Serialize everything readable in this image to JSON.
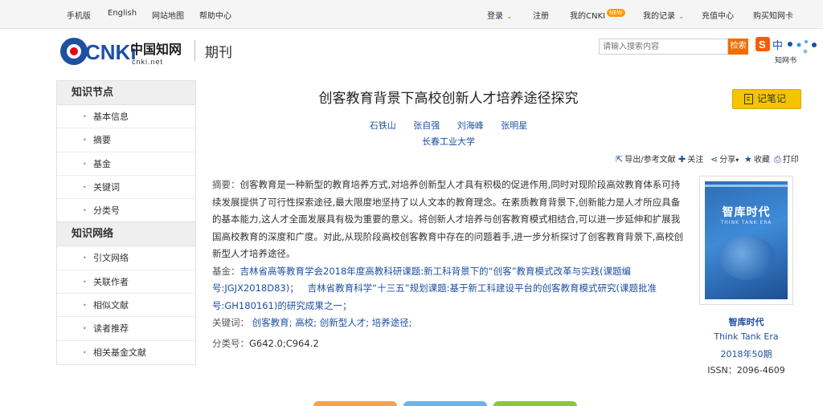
{
  "topbar": {
    "mobile": "手机版",
    "english": "English",
    "sitemap": "网站地图",
    "help": "帮助中心",
    "login": "登录",
    "register": "注册",
    "my_cnki": "我的CNKI",
    "new_badge": "NEW",
    "my_records": "我的记录",
    "recharge": "充值中心",
    "buy_card": "购买知网卡"
  },
  "header": {
    "logo_text": "CNKi",
    "logo_cn": "中国知网",
    "logo_url": "cnki.net",
    "section": "期刊",
    "search_placeholder": "请输入搜索内容",
    "search_button": "检索",
    "sogou_text": "中",
    "sogou_sub": "知网书"
  },
  "sidebar": {
    "knowledge_nodes": {
      "title": "知识节点",
      "items": [
        "基本信息",
        "摘要",
        "基金",
        "关键词",
        "分类号"
      ]
    },
    "knowledge_network": {
      "title": "知识网络",
      "items": [
        "引文网络",
        "关联作者",
        "相似文献",
        "读者推荐",
        "相关基金文献"
      ]
    }
  },
  "article": {
    "title": "创客教育背景下高校创新人才培养途径探究",
    "authors": [
      "石铁山",
      "张自强",
      "刘海峰",
      "张明星"
    ],
    "organization": "长春工业大学",
    "note_button": "记笔记",
    "tools": {
      "export": "导出/参考文献",
      "follow": "关注",
      "share": "分享",
      "favorite": "收藏",
      "print": "打印"
    },
    "abstract_label": "摘要：",
    "abstract": "创客教育是一种新型的教育培养方式,对培养创新型人才具有积极的促进作用,同时对现阶段高效教育体系可持续发展提供了可行性探索途径,最大限度地坚持了以人文本的教育理念。在素质教育背景下,创新能力是人才所应具备的基本能力,这人才全面发展具有极为重要的意义。将创新人才培养与创客教育模式相结合,可以进一步延伸和扩展我国高校教育的深度和广度。对此,从现阶段高校创客教育中存在的问题着手,进一步分析探讨了创客教育背景下,高校创新型人才培养途径。",
    "fund_label": "基金：",
    "fund_1": "吉林省高等教育学会2018年度高教科研课题:新工科背景下的“创客”教育模式改革与实践(课题编号:JGJX2018D83)；",
    "fund_2": "吉林省教育科学“十三五”规划课题:基于新工科建设平台的创客教育模式研究(课题批准号:GH180161)的研究成果之一；",
    "keywords_label": "关键词：",
    "keywords": [
      "创客教育;",
      "高校;",
      "创新型人才;",
      "培养途径;"
    ],
    "class_label": "分类号：",
    "class_code": "G642.0;C964.2"
  },
  "journal": {
    "cover_title": "智库时代",
    "cover_en": "THINK TANK ERA",
    "name": "智库时代",
    "name_en": "Think Tank Era",
    "issue": "2018年50期",
    "issn": "ISSN：2096-4609"
  },
  "colors": {
    "link": "#1e50a2",
    "accent": "#ee6f00",
    "note_button": "#f5c400"
  }
}
